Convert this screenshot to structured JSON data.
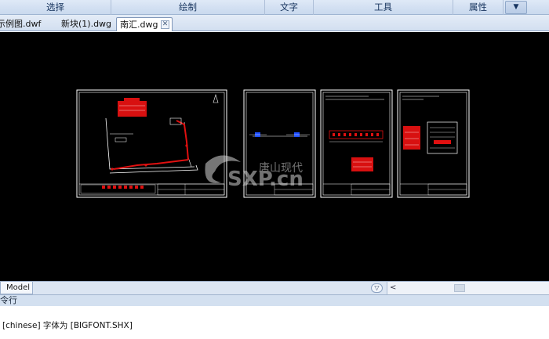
{
  "ribbon": {
    "groups": [
      "选择",
      "绘制",
      "文字",
      "工具",
      "属性"
    ],
    "dropdown_icon": "chevron-down-icon"
  },
  "tabs": [
    {
      "label": "示例图.dwf",
      "active": false
    },
    {
      "label": "新块(1).dwg",
      "active": false
    },
    {
      "label": "南汇.dwg",
      "active": true
    }
  ],
  "canvas": {
    "background": "#000000",
    "accent_red": "#e01010",
    "line_color": "#ffffff",
    "watermark": {
      "brand": "SXP.cn",
      "cn": "唐山现代"
    }
  },
  "layout_tabs": {
    "model_label": "Model",
    "scroll_left": "<"
  },
  "command": {
    "header": "令行",
    "history": "[chinese] 字体为 [BIGFONT.SHX]"
  }
}
